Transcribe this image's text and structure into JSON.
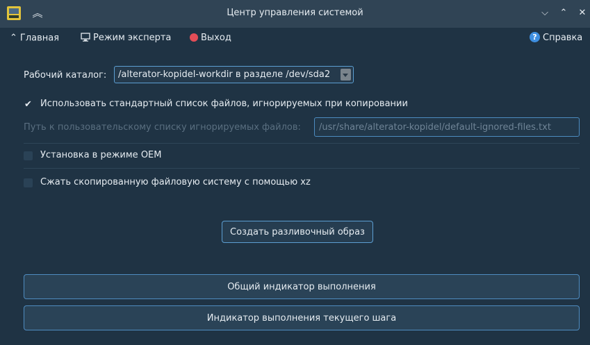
{
  "window": {
    "title": "Центр управления системой"
  },
  "toolbar": {
    "home_label": "Главная",
    "expert_label": "Режим эксперта",
    "exit_label": "Выход",
    "help_label": "Справка"
  },
  "workdir": {
    "label": "Рабочий каталог:",
    "value": "/alterator-kopidel-workdir в разделе /dev/sda2"
  },
  "options": {
    "use_standard_list": {
      "label": "Использовать стандартный список файлов, игнорируемых при копировании",
      "checked": true
    },
    "custom_ignore_list": {
      "label": "Путь к пользовательскому списку игнорируемых файлов:",
      "value": "/usr/share/alterator-kopidel/default-ignored-files.txt",
      "enabled": false
    },
    "oem_install": {
      "label": "Установка в режиме OEM",
      "checked": false
    },
    "compress_xz": {
      "label": "Сжать скопированную файловую систему с помощью xz",
      "checked": false
    }
  },
  "actions": {
    "create_image_label": "Создать разливочный образ"
  },
  "progress": {
    "total_label": "Общий индикатор выполнения",
    "total_value": 0,
    "step_label": "Индикатор выполнения текущего шага",
    "step_value": 0
  },
  "icons": {
    "app": "alt-linux-app-icon",
    "keep_above": "keep-above-icon",
    "home": "chevron-up-icon",
    "expert": "monitor-icon",
    "exit": "exit-icon",
    "help": "help-icon"
  },
  "colors": {
    "window_bg": "#1f3344",
    "titlebar_bg": "#304455",
    "accent_border": "#5c9fd3",
    "exit_red": "#e34d57",
    "help_blue": "#3f8fe0"
  }
}
